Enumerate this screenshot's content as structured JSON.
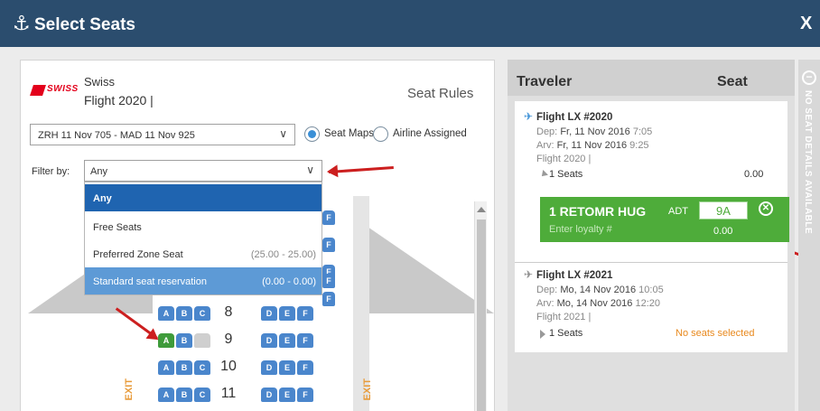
{
  "window": {
    "title": "Select Seats",
    "title_icon": "seat-icon",
    "close": "X"
  },
  "flight_header": {
    "logo_text": "SWISS",
    "airline": "Swiss",
    "flight": "Flight 2020 |",
    "seat_rules": "Seat Rules"
  },
  "flight_select": {
    "value": "ZRH 11 Nov 705 - MAD 11 Nov 925"
  },
  "view_mode": {
    "options": [
      "Seat Maps",
      "Airline Assigned"
    ],
    "selected": "Seat Maps"
  },
  "filter": {
    "label": "Filter by:",
    "value": "Any",
    "options": [
      {
        "label": "Any",
        "range": ""
      },
      {
        "label": "Free Seats",
        "range": ""
      },
      {
        "label": "Preferred Zone Seat",
        "range": "(25.00 - 25.00)"
      },
      {
        "label": "Standard seat reservation",
        "range": "(0.00 - 0.00)"
      }
    ]
  },
  "seatmap": {
    "exit_label": "EXIT",
    "rows": [
      "8",
      "9",
      "10",
      "11"
    ],
    "left_letters": [
      "A",
      "B",
      "C"
    ],
    "right_letters": [
      "D",
      "E",
      "F"
    ],
    "selected_seat": "9A",
    "occupied_seat": "9C"
  },
  "traveler_panel": {
    "header_traveler": "Traveler",
    "header_seat": "Seat",
    "flights": [
      {
        "title": "Flight LX #2020",
        "dep_label": "Dep:",
        "dep_date": "Fr, 11 Nov 2016",
        "dep_time": "7:05",
        "arv_label": "Arv:",
        "arv_date": "Fr, 11 Nov 2016",
        "arv_time": "9:25",
        "flight_line": "Flight 2020 |",
        "seats": "1 Seats",
        "seats_price": "0.00",
        "traveler": {
          "name": "1 RETOMR HUG",
          "type": "ADT",
          "seat": "9A",
          "loyalty_placeholder": "Enter loyalty #",
          "price": "0.00"
        }
      },
      {
        "title": "Flight LX #2021",
        "dep_label": "Dep:",
        "dep_date": "Mo, 14 Nov 2016",
        "dep_time": "10:05",
        "arv_label": "Arv:",
        "arv_date": "Mo, 14 Nov 2016",
        "arv_time": "12:20",
        "flight_line": "Flight 2021 |",
        "seats": "1 Seats",
        "status": "No seats selected"
      }
    ]
  },
  "side_tab": {
    "text": "NO SEAT DETAILS AVAILABLE"
  },
  "colors": {
    "titlebar": "#2b4d6e",
    "seat_available": "#4a86cc",
    "seat_selected": "#3e9b3a",
    "traveler_row": "#4eac3a",
    "annotation_arrow": "#cc1f1f",
    "no_seats_text": "#e8891e"
  }
}
